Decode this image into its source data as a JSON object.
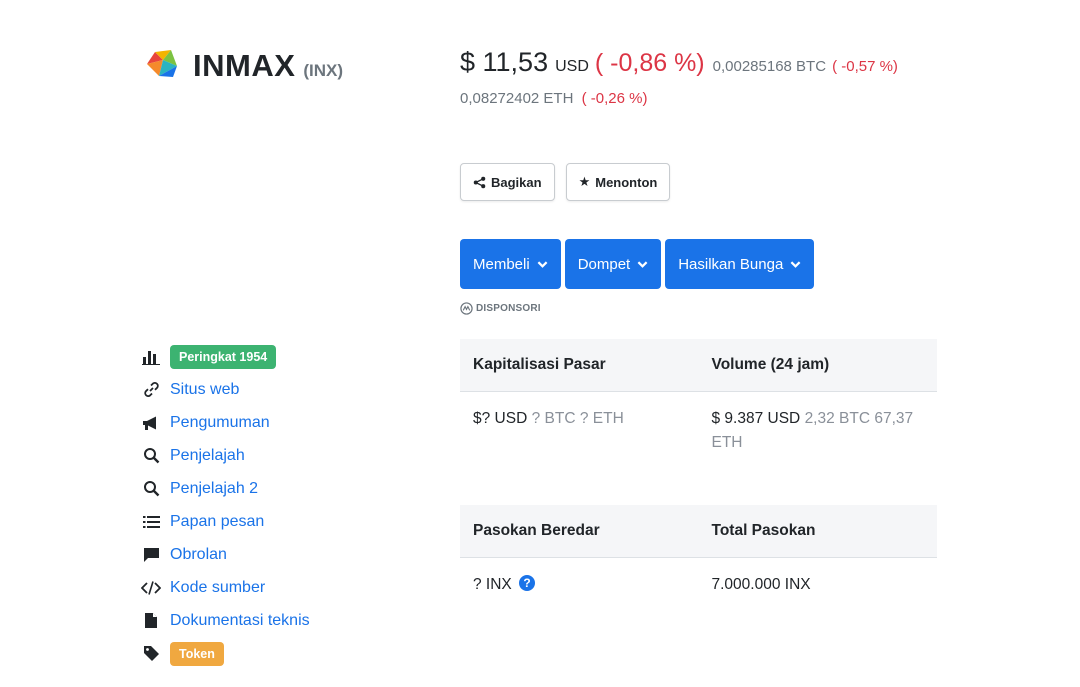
{
  "coin": {
    "name": "INMAX",
    "symbol": "(INX)",
    "logo_icon": "inmax-logo"
  },
  "price": {
    "main": "$ 11,53",
    "currency": "USD",
    "change_usd": "( -0,86 %)",
    "btc": "0,00285168 BTC",
    "change_btc": "( -0,57 %)",
    "eth": "0,08272402 ETH",
    "change_eth": "( -0,26 %)",
    "negative_color": "#dc3545"
  },
  "actions": {
    "share_label": "Bagikan",
    "share_icon": "share-icon",
    "watch_label": "Menonton",
    "watch_icon": "star-icon"
  },
  "dropdowns": [
    {
      "label": "Membeli"
    },
    {
      "label": "Dompet"
    },
    {
      "label": "Hasilkan Bunga"
    }
  ],
  "sponsored_label": "DISPONSORI",
  "sidebar": {
    "rank_label": "Peringkat 1954",
    "items": [
      {
        "label": "Situs web",
        "icon": "link-icon"
      },
      {
        "label": "Pengumuman",
        "icon": "megaphone-icon"
      },
      {
        "label": "Penjelajah",
        "icon": "search-icon"
      },
      {
        "label": "Penjelajah 2",
        "icon": "search-icon"
      },
      {
        "label": "Papan pesan",
        "icon": "list-icon"
      },
      {
        "label": "Obrolan",
        "icon": "chat-icon"
      },
      {
        "label": "Kode sumber",
        "icon": "code-icon"
      },
      {
        "label": "Dokumentasi teknis",
        "icon": "document-icon"
      }
    ],
    "tag_label": "Token"
  },
  "market": {
    "cap_header": "Kapitalisasi Pasar",
    "cap_usd": "$? USD",
    "cap_btc": "? BTC",
    "cap_eth": "? ETH",
    "volume_header": "Volume (24 jam)",
    "volume_usd": "$ 9.387 USD",
    "volume_btc": "2,32 BTC",
    "volume_eth": "67,37 ETH"
  },
  "supply": {
    "circulating_header": "Pasokan Beredar",
    "circulating_value": "? INX",
    "total_header": "Total Pasokan",
    "total_value": "7.000.000 INX",
    "help_glyph": "?"
  },
  "colors": {
    "link": "#1a73e8",
    "primary_button": "#1a73e8",
    "rank_badge": "#3cb371",
    "token_badge": "#f0a840"
  }
}
